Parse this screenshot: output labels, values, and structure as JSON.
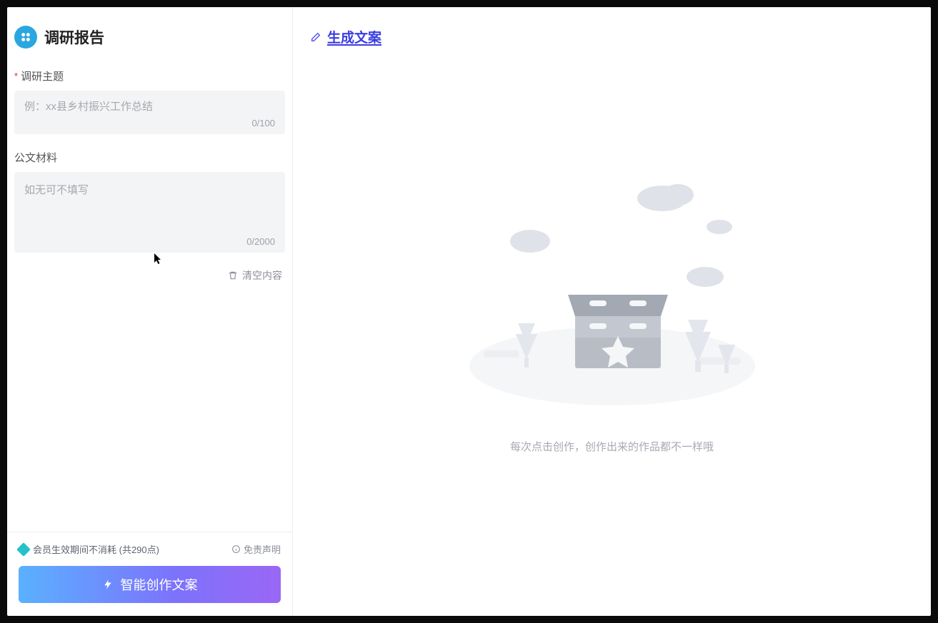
{
  "sidebar": {
    "title": "调研报告",
    "field_topic": {
      "label": "调研主题",
      "placeholder": "例：xx县乡村振兴工作总结",
      "counter": "0/100"
    },
    "field_material": {
      "label": "公文材料",
      "placeholder": "如无可不填写",
      "counter": "0/2000"
    },
    "clear_label": "清空内容",
    "footer": {
      "points_text": "会员生效期间不消耗 (共290点)",
      "disclaimer": "免责声明",
      "create_button": "智能创作文案"
    }
  },
  "main": {
    "header_title": "生成文案",
    "empty_hint": "每次点击创作，创作出来的作品都不一样哦"
  }
}
